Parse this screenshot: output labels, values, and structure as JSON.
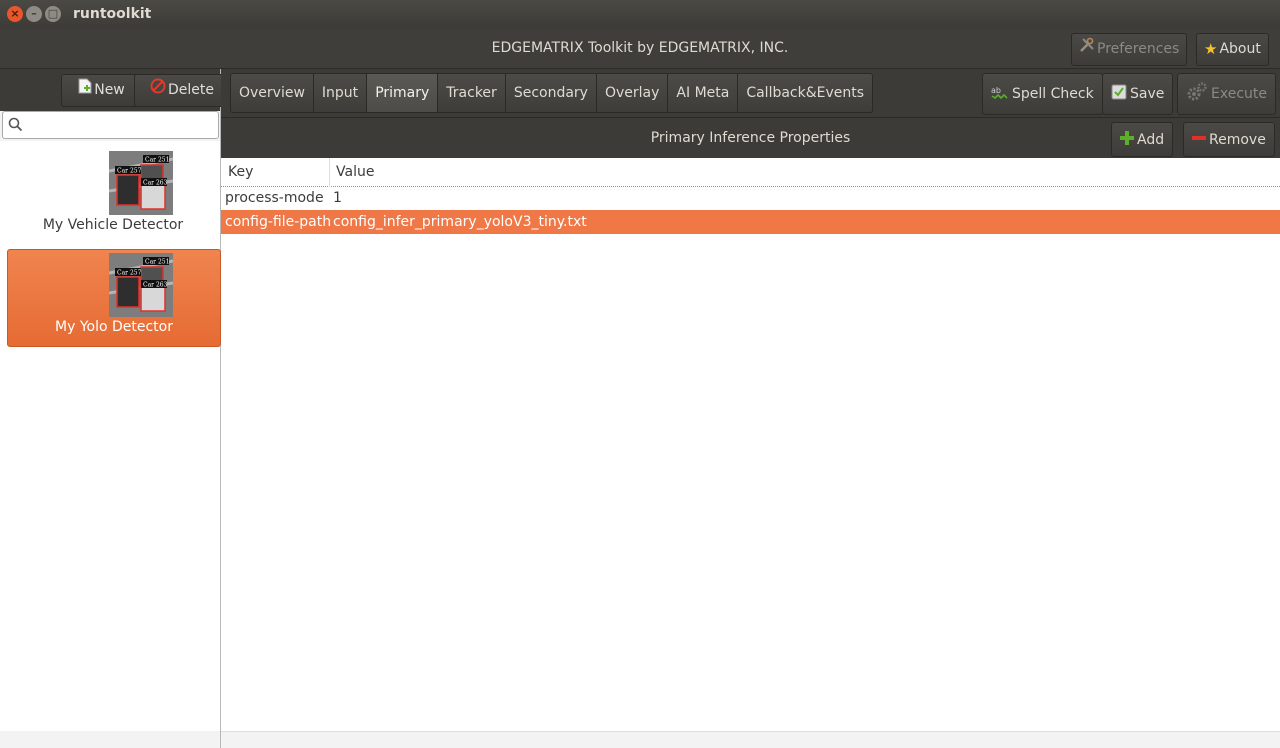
{
  "window": {
    "title": "runtoolkit"
  },
  "header": {
    "title": "EDGEMATRIX Toolkit by EDGEMATRIX, INC.",
    "preferences_label": "Preferences",
    "about_label": "About"
  },
  "sidebar": {
    "new_label": "New",
    "delete_label": "Delete",
    "search_placeholder": "",
    "items": [
      {
        "label": "My Vehicle Detector",
        "selected": false
      },
      {
        "label": "My Yolo Detector",
        "selected": true
      }
    ],
    "thumb_tags": [
      "Car 251",
      "Car 257",
      "Car 263"
    ]
  },
  "tabs": [
    "Overview",
    "Input",
    "Primary",
    "Tracker",
    "Secondary",
    "Overlay",
    "AI Meta",
    "Callback&Events"
  ],
  "active_tab": "Primary",
  "toolbar": {
    "spellcheck_label": "Spell Check",
    "save_label": "Save",
    "execute_label": "Execute"
  },
  "properties": {
    "title": "Primary Inference Properties",
    "add_label": "Add",
    "remove_label": "Remove",
    "columns": [
      "Key",
      "Value"
    ],
    "rows": [
      {
        "key": "process-mode",
        "value": "1",
        "selected": false
      },
      {
        "key": "config-file-path",
        "value": "config_infer_primary_yoloV3_tiny.txt",
        "selected": true
      }
    ]
  },
  "colors": {
    "accent": "#f07746",
    "titlebar": "#3c3b37",
    "close_button": "#e8562a"
  }
}
